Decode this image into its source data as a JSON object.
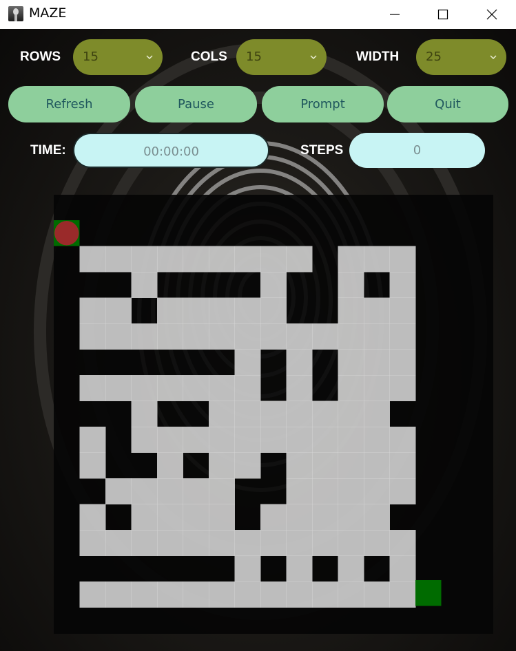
{
  "window": {
    "title": "MAZE"
  },
  "controls": {
    "rows": {
      "label": "ROWS",
      "value": "15"
    },
    "cols": {
      "label": "COLS",
      "value": "15"
    },
    "width": {
      "label": "WIDTH",
      "value": "25"
    }
  },
  "buttons": {
    "refresh": "Refresh",
    "pause": "Pause",
    "prompt": "Prompt",
    "quit": "Quit"
  },
  "status": {
    "time_label": "TIME:",
    "time_value": "00:00:00",
    "steps_label": "STEPS",
    "steps_value": "0"
  },
  "colors": {
    "select_bg": "#7e8b2a",
    "button_bg": "#8ecf9c",
    "field_bg": "#c8f4f4",
    "maze_path": "#d7d7d7",
    "maze_wall": "#050505",
    "marker_green": "#006b00",
    "player_red": "#9a2a2a"
  },
  "maze": {
    "size": 15,
    "start": [
      0,
      0
    ],
    "end": [
      14,
      14
    ],
    "player": [
      0,
      0
    ],
    "grid": [
      "000000000000000",
      "0PPPPPPPPP0PPP0",
      "000P0000P00P0P0",
      "0PP0PPPPP00PPP0",
      "0PPPPPPPPPPPPP0",
      "0000000P0P0PPP0",
      "0PPPPPPP0P0PPP0",
      "000P00PPPPPPP00",
      "0P0PPPPPPPPPPP0",
      "0P00P0PP0PPPPP0",
      "00PPPPP00PPPPP0",
      "0P0PPPP0PPPPP00",
      "0PPPPPPPPPPPPP0",
      "0000000P0P0P0P0",
      "0PPPPPPPPPPPPP0"
    ]
  }
}
